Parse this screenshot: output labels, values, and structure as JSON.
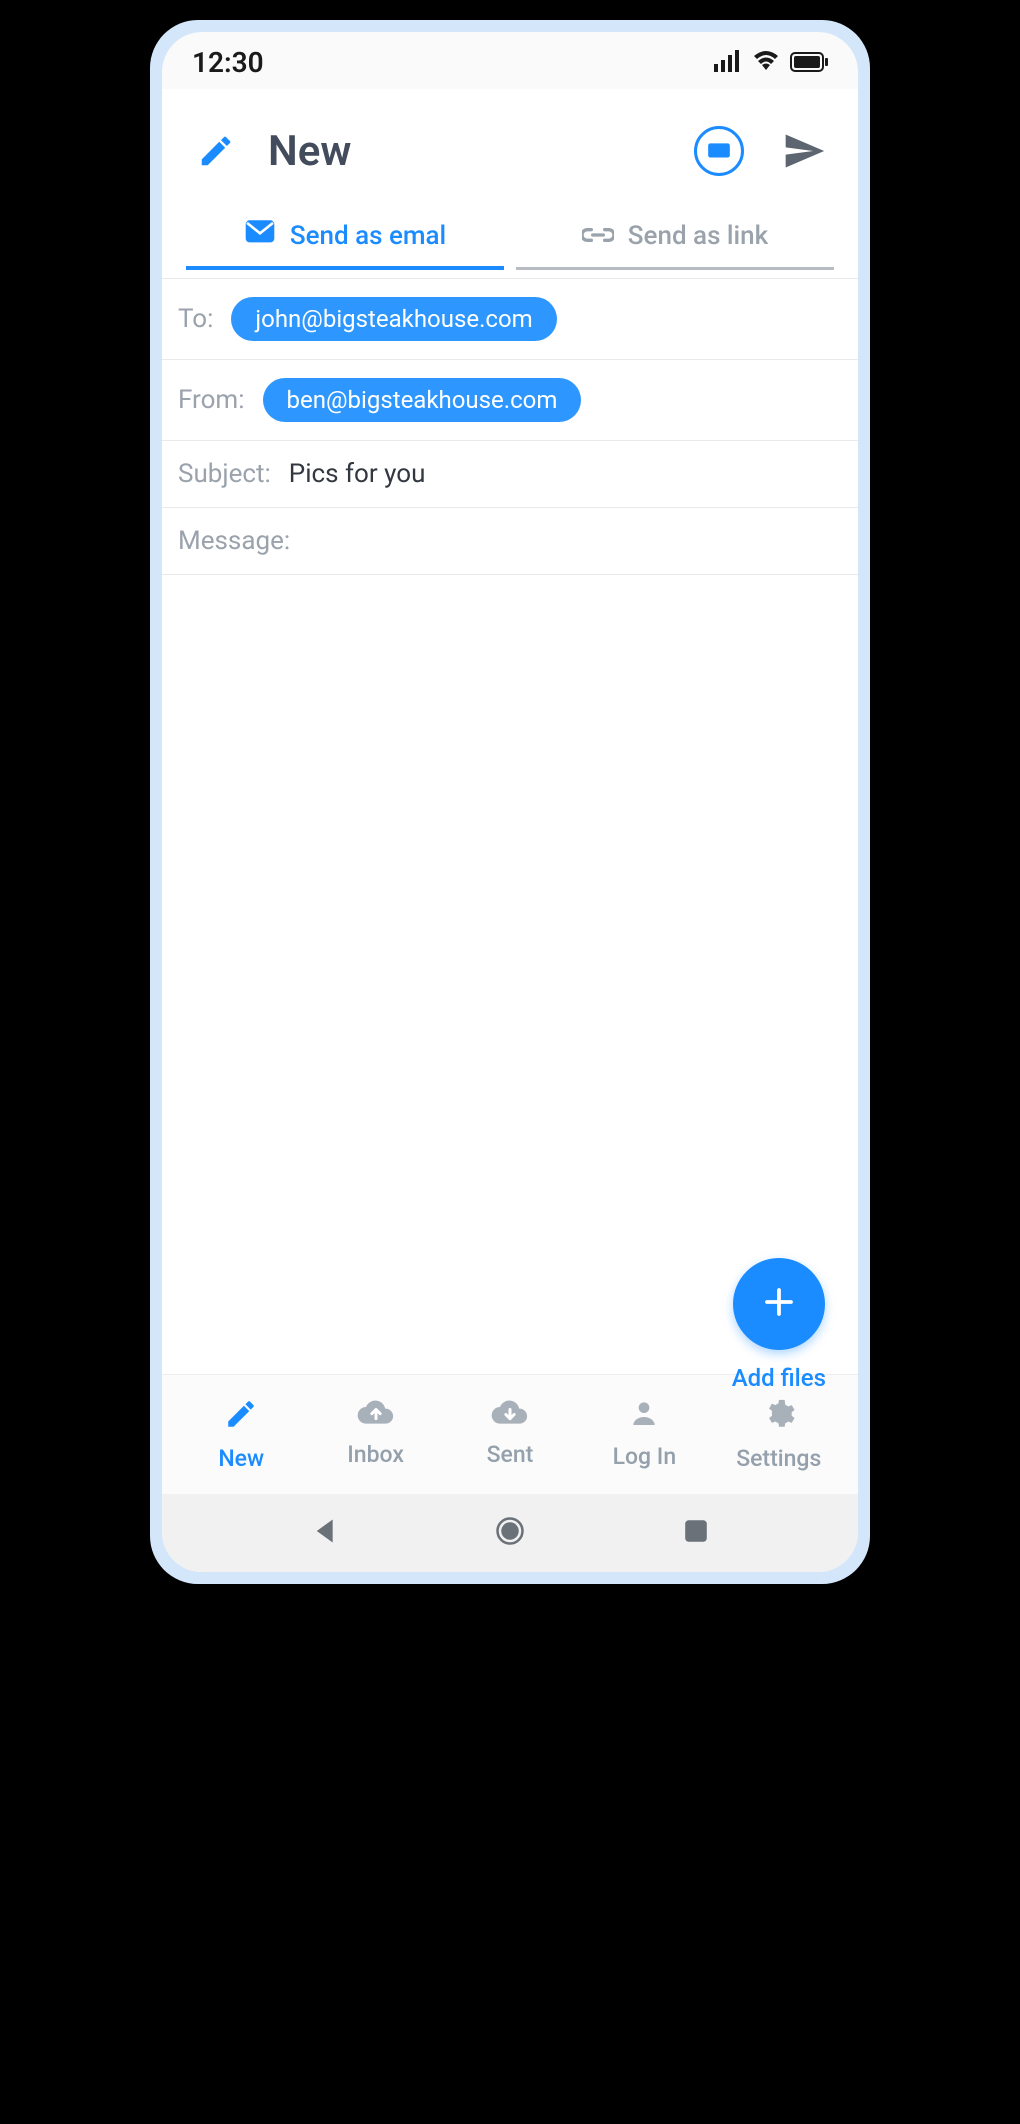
{
  "statusBar": {
    "time": "12:30"
  },
  "header": {
    "title": "New"
  },
  "tabs": {
    "email": "Send as emal",
    "link": "Send as link"
  },
  "fields": {
    "toLabel": "To:",
    "toValue": "john@bigsteakhouse.com",
    "fromLabel": "From:",
    "fromValue": "ben@bigsteakhouse.com",
    "subjectLabel": "Subject:",
    "subjectValue": "Pics for you",
    "messageLabel": "Message:"
  },
  "fab": {
    "label": "Add files"
  },
  "nav": {
    "new": "New",
    "inbox": "Inbox",
    "sent": "Sent",
    "login": "Log In",
    "settings": "Settings"
  }
}
